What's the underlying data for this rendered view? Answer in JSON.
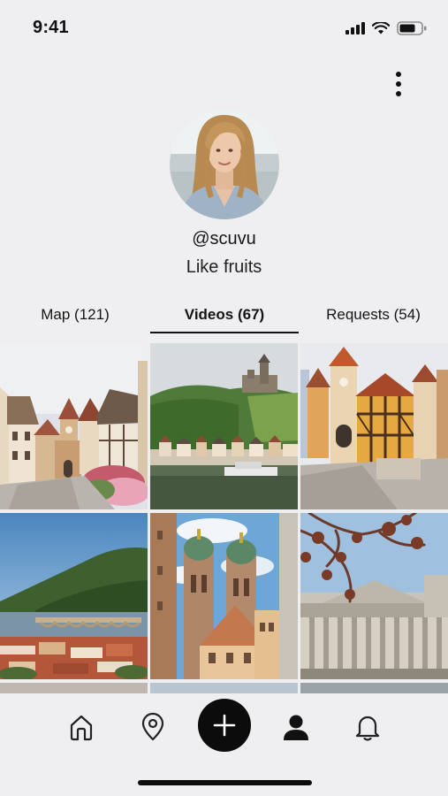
{
  "status_bar": {
    "time": "9:41"
  },
  "profile": {
    "username": "@scuvu",
    "bio": "Like fruits"
  },
  "tabs": [
    {
      "label": "Map (121)",
      "active": false
    },
    {
      "label": "Videos (67)",
      "active": true
    },
    {
      "label": "Requests (54)",
      "active": false
    }
  ],
  "grid": {
    "items": [
      {
        "subject": "half-timbered town street with clock tower"
      },
      {
        "subject": "castle on hill above river town"
      },
      {
        "subject": "half-timbered gate tower square"
      },
      {
        "subject": "old bridge and town below wooded hill"
      },
      {
        "subject": "twin-domed cathedral towers"
      },
      {
        "subject": "columned government building"
      }
    ]
  },
  "bottom_nav": {
    "items": [
      "home-icon",
      "location-pin-icon",
      "plus-icon",
      "user-icon",
      "bell-icon"
    ],
    "active": "user-icon"
  },
  "colors": {
    "background": "#efeff1",
    "text": "#111111",
    "accent": "#0c0c0c"
  }
}
